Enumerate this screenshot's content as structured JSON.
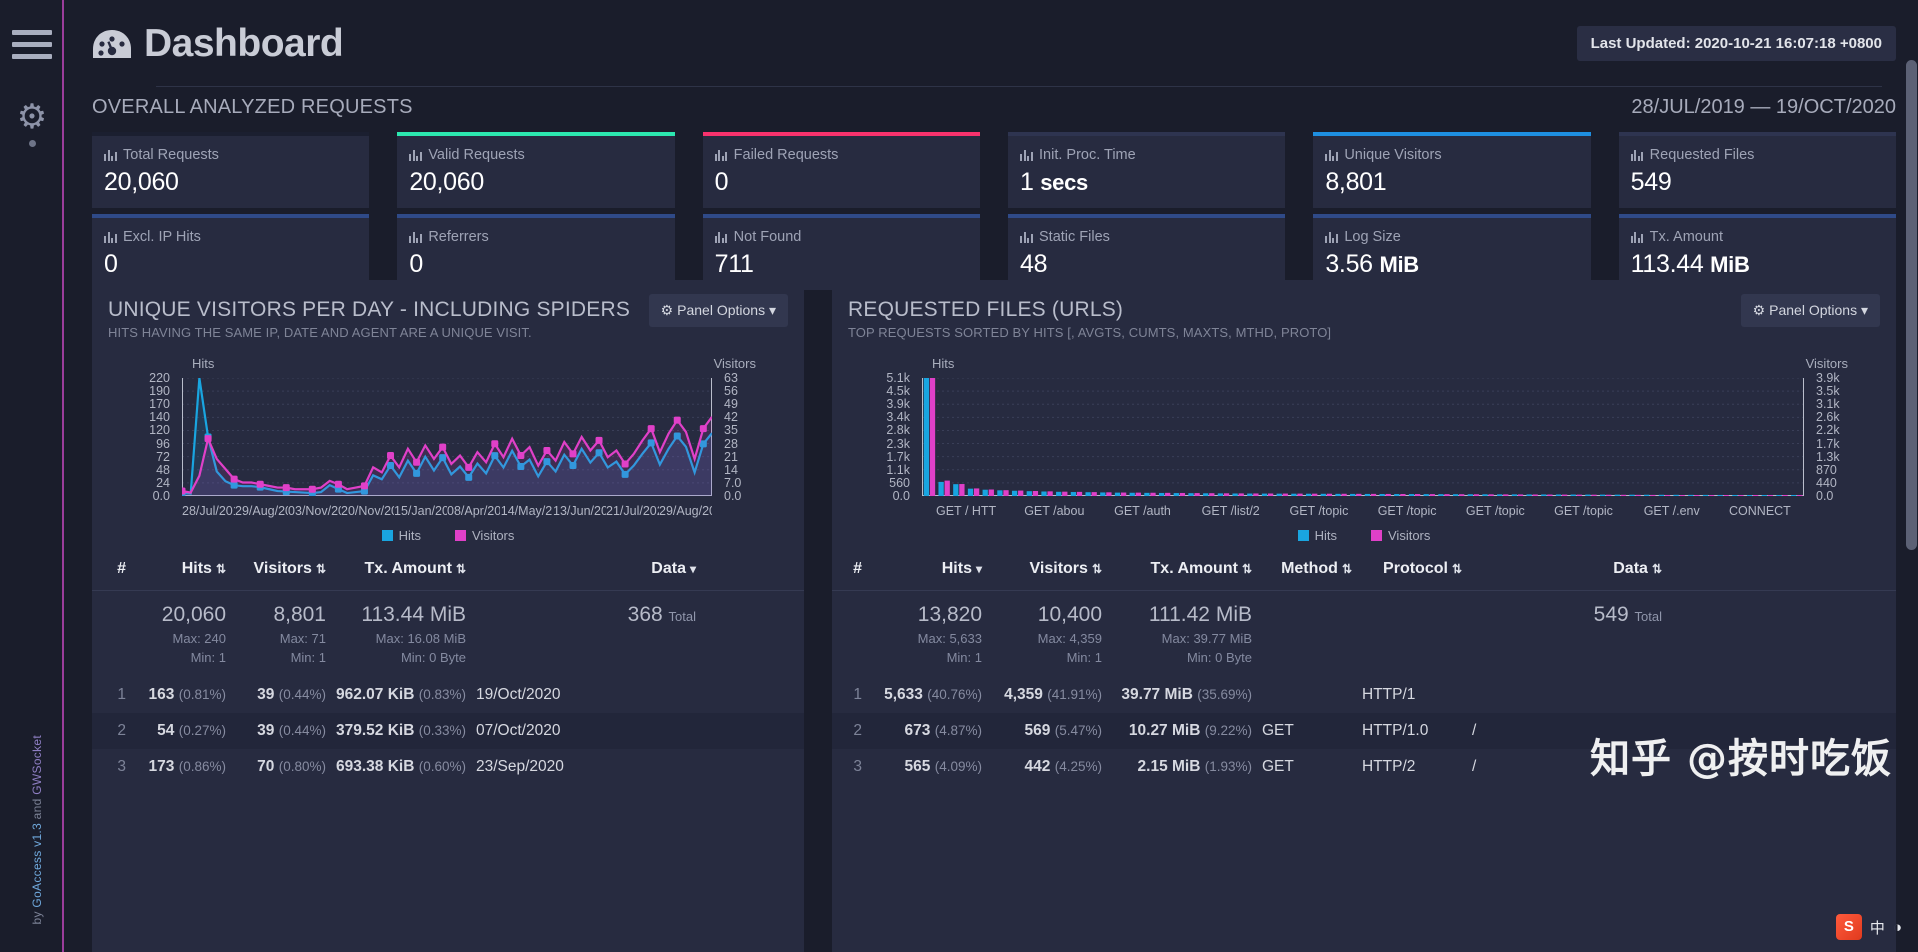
{
  "sidebar": {
    "menu_label": "menu",
    "gear_label": "settings",
    "footer_prefix": "by ",
    "footer_goaccess": "GoAccess v1.3",
    "footer_middle": " and ",
    "footer_gwsocket": "GWSocket"
  },
  "header": {
    "title": "Dashboard",
    "last_updated": "Last Updated: 2020-10-21 16:07:18 +0800"
  },
  "overall": {
    "title": "OVERALL ANALYZED REQUESTS",
    "date_range": "28/JUL/2019 — 19/OCT/2020",
    "cards": [
      {
        "label": "Total Requests",
        "value": "20,060",
        "accent": "#1b1f30"
      },
      {
        "label": "Valid Requests",
        "value": "20,060",
        "accent": "#2ce8b0"
      },
      {
        "label": "Failed Requests",
        "value": "0",
        "accent": "#f8326d"
      },
      {
        "label": "Init. Proc. Time",
        "value": "1 secs",
        "accent": "#2e3450"
      },
      {
        "label": "Unique Visitors",
        "value": "8,801",
        "accent": "#1e8fe1"
      },
      {
        "label": "Requested Files",
        "value": "549",
        "accent": "#2e3450"
      },
      {
        "label": "Excl. IP Hits",
        "value": "0",
        "accent": "#2f4a88"
      },
      {
        "label": "Referrers",
        "value": "0",
        "accent": "#2f4a88"
      },
      {
        "label": "Not Found",
        "value": "711",
        "accent": "#2f4a88"
      },
      {
        "label": "Static Files",
        "value": "48",
        "accent": "#2f4a88"
      },
      {
        "label": "Log Size",
        "value": "3.56 MiB",
        "accent": "#2f4a88"
      },
      {
        "label": "Tx. Amount",
        "value": "113.44 MiB",
        "accent": "#2f4a88"
      }
    ]
  },
  "colors": {
    "hits": "#19a5e0",
    "visitors": "#e040c8",
    "panel_bg": "#272b40"
  },
  "panel_left": {
    "title": "UNIQUE VISITORS PER DAY - INCLUDING SPIDERS",
    "subtitle": "HITS HAVING THE SAME IP, DATE AND AGENT ARE A UNIQUE VISIT.",
    "options_label": "Panel Options",
    "chart_data": {
      "type": "line",
      "title": "UNIQUE VISITORS PER DAY - INCLUDING SPIDERS",
      "xlabel": "",
      "ylabel": "Hits",
      "y2label": "Visitors",
      "grid": true,
      "legend": [
        "Hits",
        "Visitors"
      ],
      "ylim": [
        0,
        240
      ],
      "y2lim": [
        0,
        70
      ],
      "yticks": [
        "220",
        "190",
        "170",
        "140",
        "120",
        "96",
        "72",
        "48",
        "24",
        "0.0"
      ],
      "y2ticks": [
        "63",
        "56",
        "49",
        "42",
        "35",
        "28",
        "21",
        "14",
        "7.0",
        "0.0"
      ],
      "xtick_labels": [
        "28/Jul/201",
        "29/Aug/20",
        "03/Nov/20",
        "20/Nov/20",
        "15/Jan/20",
        "08/Apr/20",
        "14/May/2",
        "13/Jun/20",
        "21/Jul/202",
        "29/Aug/20"
      ],
      "series": [
        {
          "name": "Hits",
          "color": "#19a5e0",
          "values": [
            6,
            5,
            240,
            120,
            50,
            30,
            22,
            20,
            20,
            18,
            14,
            10,
            9,
            8,
            7,
            6,
            8,
            22,
            14,
            6,
            8,
            10,
            42,
            34,
            62,
            38,
            72,
            46,
            80,
            52,
            78,
            44,
            60,
            38,
            66,
            46,
            82,
            58,
            92,
            60,
            74,
            40,
            70,
            50,
            84,
            62,
            96,
            68,
            88,
            58,
            70,
            44,
            62,
            86,
            108,
            64,
            96,
            122,
            100,
            48,
            106,
            128
          ]
        },
        {
          "name": "Visitors",
          "color": "#e040c8",
          "values": [
            3,
            2,
            12,
            34,
            22,
            16,
            10,
            8,
            8,
            7,
            6,
            5,
            5,
            4,
            4,
            4,
            5,
            9,
            7,
            4,
            5,
            6,
            17,
            14,
            24,
            17,
            28,
            20,
            30,
            22,
            29,
            19,
            24,
            17,
            26,
            20,
            31,
            23,
            34,
            24,
            29,
            18,
            27,
            21,
            32,
            25,
            35,
            27,
            33,
            23,
            27,
            19,
            25,
            33,
            40,
            26,
            37,
            45,
            38,
            22,
            40,
            47
          ]
        }
      ]
    },
    "table": {
      "headers": [
        "#",
        "Hits",
        "Visitors",
        "Tx. Amount",
        "Data"
      ],
      "sorted_column": "Data",
      "summary": {
        "hits": "20,060",
        "visitors": "8,801",
        "tx": "113.44 MiB",
        "data_count": "368",
        "data_word": "Total",
        "hits_max": "Max: 240",
        "visitors_max": "Max: 71",
        "tx_max": "Max: 16.08 MiB",
        "hits_min": "Min: 1",
        "visitors_min": "Min: 1",
        "tx_min": "Min: 0 Byte"
      },
      "rows": [
        {
          "idx": "1",
          "hits": "163",
          "hits_pct": "(0.81%)",
          "visitors": "39",
          "visitors_pct": "(0.44%)",
          "tx": "962.07 KiB",
          "tx_pct": "(0.83%)",
          "data": "19/Oct/2020"
        },
        {
          "idx": "2",
          "hits": "54",
          "hits_pct": "(0.27%)",
          "visitors": "39",
          "visitors_pct": "(0.44%)",
          "tx": "379.52 KiB",
          "tx_pct": "(0.33%)",
          "data": "07/Oct/2020"
        },
        {
          "idx": "3",
          "hits": "173",
          "hits_pct": "(0.86%)",
          "visitors": "70",
          "visitors_pct": "(0.80%)",
          "tx": "693.38 KiB",
          "tx_pct": "(0.60%)",
          "data": "23/Sep/2020"
        }
      ]
    }
  },
  "panel_right": {
    "title": "REQUESTED FILES (URLS)",
    "subtitle": "TOP REQUESTS SORTED BY HITS [, AVGTS, CUMTS, MAXTS, MTHD, PROTO]",
    "options_label": "Panel Options",
    "chart_data": {
      "type": "bar",
      "title": "REQUESTED FILES (URLS)",
      "xlabel": "",
      "ylabel": "Hits",
      "y2label": "Visitors",
      "grid": true,
      "legend": [
        "Hits",
        "Visitors"
      ],
      "ylim": [
        0,
        5633
      ],
      "y2lim": [
        0,
        4359
      ],
      "yticks": [
        "5.1k",
        "4.5k",
        "3.9k",
        "3.4k",
        "2.8k",
        "2.3k",
        "1.7k",
        "1.1k",
        "560",
        "0.0"
      ],
      "y2ticks": [
        "3.9k",
        "3.5k",
        "3.1k",
        "2.6k",
        "2.2k",
        "1.7k",
        "1.3k",
        "870",
        "440",
        "0.0"
      ],
      "categories": [
        "GET / HTT",
        "GET /abou",
        "GET /auth",
        "GET /list/2",
        "GET /topic",
        "GET /topic",
        "GET /topic",
        "GET /topic",
        "GET /.env",
        "CONNECT"
      ],
      "series": [
        {
          "name": "Hits",
          "color": "#19a5e0",
          "values": [
            5633,
            673,
            565,
            350,
            300,
            270,
            250,
            230,
            215,
            200,
            190,
            180,
            170,
            160,
            155,
            150,
            145,
            140,
            135,
            130,
            125,
            120,
            118,
            115,
            112,
            110,
            108,
            105,
            102,
            100,
            98,
            96,
            94,
            92,
            90,
            88,
            86,
            84,
            82,
            80,
            78,
            76,
            74,
            72,
            70,
            68,
            66,
            64,
            62,
            60,
            58,
            56,
            54,
            52,
            50,
            48,
            46,
            44,
            42,
            40
          ]
        },
        {
          "name": "Visitors",
          "color": "#e040c8",
          "values": [
            4359,
            569,
            442,
            280,
            240,
            215,
            200,
            185,
            172,
            160,
            152,
            144,
            136,
            128,
            124,
            120,
            116,
            112,
            108,
            104,
            100,
            96,
            94,
            92,
            90,
            88,
            86,
            84,
            82,
            80,
            78,
            76,
            74,
            72,
            70,
            68,
            66,
            64,
            62,
            60,
            58,
            56,
            54,
            52,
            50,
            48,
            46,
            44,
            42,
            40,
            38,
            36,
            34,
            32,
            30,
            28,
            26,
            24,
            22,
            20
          ]
        }
      ]
    },
    "table": {
      "headers": [
        "#",
        "Hits",
        "Visitors",
        "Tx. Amount",
        "Method",
        "Protocol",
        "Data"
      ],
      "sorted_column": "Hits",
      "summary": {
        "hits": "13,820",
        "visitors": "10,400",
        "tx": "111.42 MiB",
        "data_count": "549",
        "data_word": "Total",
        "hits_max": "Max: 5,633",
        "visitors_max": "Max: 4,359",
        "tx_max": "Max: 39.77 MiB",
        "hits_min": "Min: 1",
        "visitors_min": "Min: 1",
        "tx_min": "Min: 0 Byte"
      },
      "rows": [
        {
          "idx": "1",
          "hits": "5,633",
          "hits_pct": "(40.76%)",
          "visitors": "4,359",
          "visitors_pct": "(41.91%)",
          "tx": "39.77 MiB",
          "tx_pct": "(35.69%)",
          "method": "",
          "protocol": "HTTP/1",
          "data": ""
        },
        {
          "idx": "2",
          "hits": "673",
          "hits_pct": "(4.87%)",
          "visitors": "569",
          "visitors_pct": "(5.47%)",
          "tx": "10.27 MiB",
          "tx_pct": "(9.22%)",
          "method": "GET",
          "protocol": "HTTP/1.0",
          "data": "/"
        },
        {
          "idx": "3",
          "hits": "565",
          "hits_pct": "(4.09%)",
          "visitors": "442",
          "visitors_pct": "(4.25%)",
          "tx": "2.15 MiB",
          "tx_pct": "(1.93%)",
          "method": "GET",
          "protocol": "HTTP/2",
          "data": "/"
        }
      ]
    }
  },
  "watermark": {
    "text": "知乎 @按时吃饭"
  },
  "tray": {
    "ime_icon": "S",
    "ime_label": "中",
    "extra": "◑"
  }
}
